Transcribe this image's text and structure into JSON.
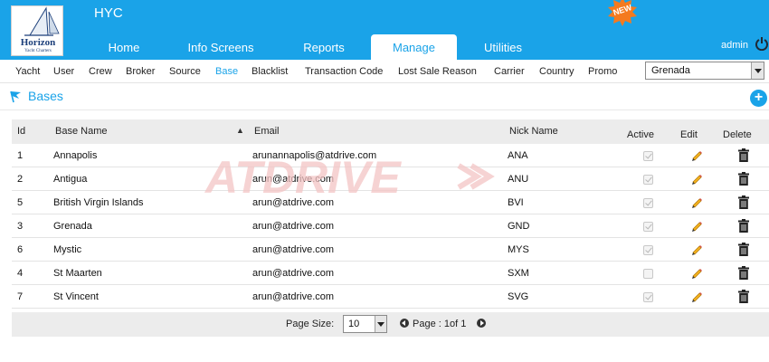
{
  "header": {
    "app_title": "HYC",
    "logo_name": "Horizon",
    "logo_sub": "Yacht Charters",
    "new_badge": "NEW",
    "user": "admin",
    "tabs": [
      {
        "label": "Home",
        "active": false
      },
      {
        "label": "Info Screens",
        "active": false
      },
      {
        "label": "Reports",
        "active": false
      },
      {
        "label": "Manage",
        "active": true
      },
      {
        "label": "Utilities",
        "active": false
      }
    ]
  },
  "subnav": {
    "items": [
      "Yacht",
      "User",
      "Crew",
      "Broker",
      "Source",
      "Base",
      "Blacklist",
      "Transaction Code",
      "Lost Sale Reason",
      "Carrier",
      "Country",
      "Promo"
    ],
    "active": "Base",
    "base_select": "Grenada"
  },
  "section": {
    "title": "Bases"
  },
  "table": {
    "columns": {
      "id": "Id",
      "base_name": "Base Name",
      "email": "Email",
      "nick_name": "Nick Name",
      "active": "Active",
      "edit": "Edit",
      "delete": "Delete"
    },
    "rows": [
      {
        "id": "1",
        "name": "Annapolis",
        "email": "arunannapolis@atdrive.com",
        "nick": "ANA",
        "active": true
      },
      {
        "id": "2",
        "name": "Antigua",
        "email": "arun@atdrive.com",
        "nick": "ANU",
        "active": true
      },
      {
        "id": "5",
        "name": "British Virgin Islands",
        "email": "arun@atdrive.com",
        "nick": "BVI",
        "active": true
      },
      {
        "id": "3",
        "name": "Grenada",
        "email": "arun@atdrive.com",
        "nick": "GND",
        "active": true
      },
      {
        "id": "6",
        "name": "Mystic",
        "email": "arun@atdrive.com",
        "nick": "MYS",
        "active": true
      },
      {
        "id": "4",
        "name": "St Maarten",
        "email": "arun@atdrive.com",
        "nick": "SXM",
        "active": false
      },
      {
        "id": "7",
        "name": "St Vincent",
        "email": "arun@atdrive.com",
        "nick": "SVG",
        "active": true
      }
    ]
  },
  "pager": {
    "page_size_label": "Page Size:",
    "page_size": "10",
    "page_text": "Page : 1of 1"
  },
  "watermark": "ATDRIVE",
  "colors": {
    "accent": "#1aa3e8",
    "badge": "#f47a1f",
    "watermark": "#f3c4c4"
  }
}
